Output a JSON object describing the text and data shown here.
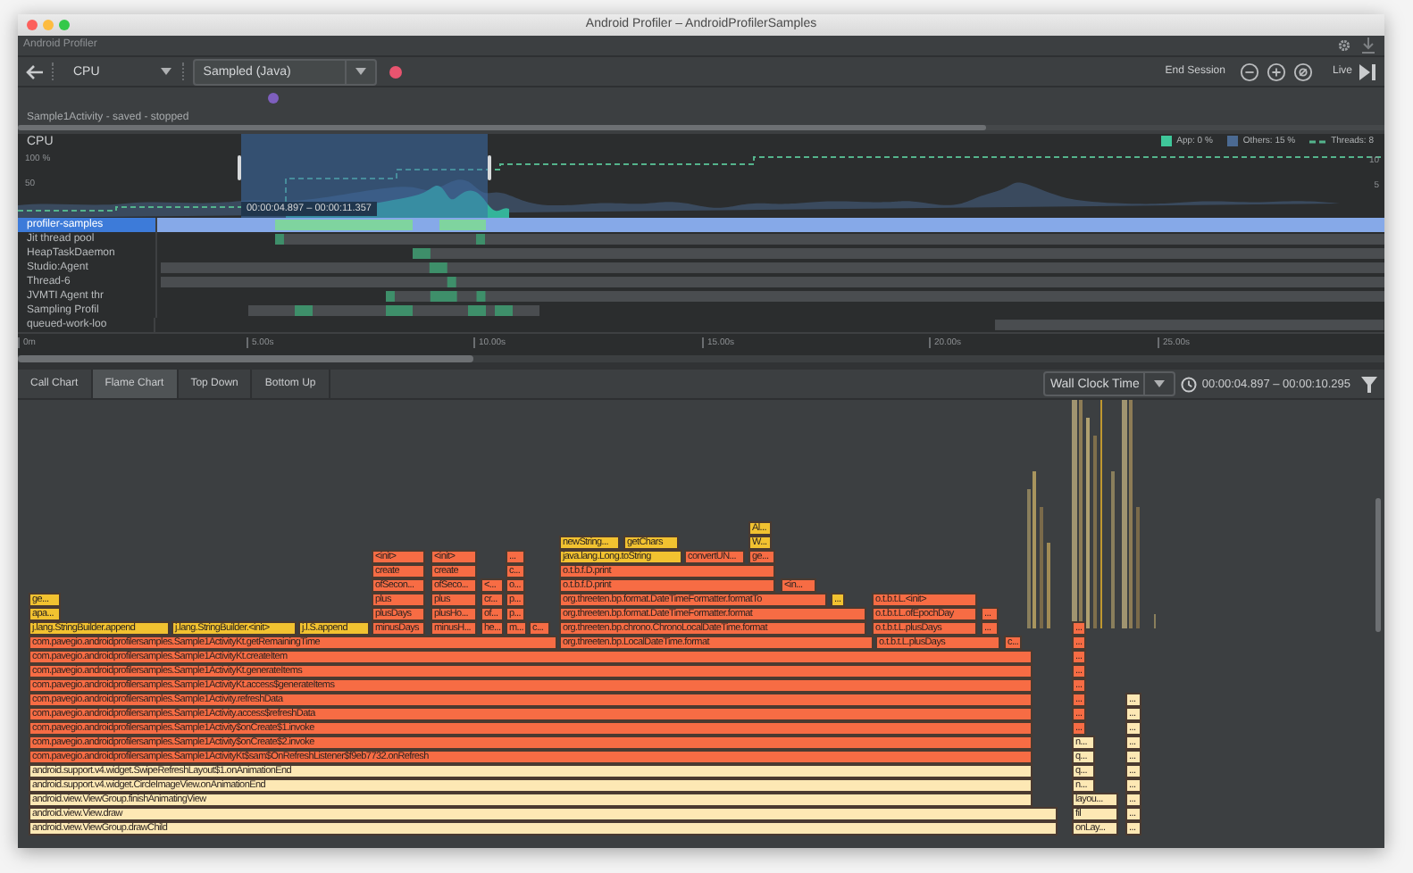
{
  "window": {
    "title": "Android Profiler – AndroidProfilerSamples"
  },
  "tool_window": {
    "title": "Android Profiler"
  },
  "toolbar": {
    "monitor": "CPU",
    "config": "Sampled (Java)",
    "end_session": "End Session",
    "live": "Live"
  },
  "session": {
    "label": "Sample1Activity - saved - stopped"
  },
  "cpu": {
    "title": "CPU",
    "y_labels": [
      "100 %",
      "50"
    ],
    "right_labels": [
      "10",
      "5"
    ],
    "legend": [
      {
        "label": "App: 0 %",
        "kind": "app"
      },
      {
        "label": "Others: 15 %",
        "kind": "others"
      },
      {
        "label": "Threads: 8",
        "kind": "threads"
      }
    ],
    "selection_range": "00:00:04.897 – 00:00:11.357"
  },
  "threads": [
    {
      "name": "profiler-samples",
      "selected": true
    },
    {
      "name": "Jit thread pool",
      "selected": false
    },
    {
      "name": "HeapTaskDaemon",
      "selected": false
    },
    {
      "name": "Studio:Agent",
      "selected": false
    },
    {
      "name": "Thread-6",
      "selected": false
    },
    {
      "name": "JVMTI Agent thr",
      "selected": false
    },
    {
      "name": "Sampling Profil",
      "selected": false
    },
    {
      "name": "queued-work-loo",
      "selected": false
    }
  ],
  "time_axis": [
    "0m",
    "5.00s",
    "10.00s",
    "15.00s",
    "20.00s",
    "25.00s"
  ],
  "tabs": [
    {
      "label": "Call Chart",
      "selected": false
    },
    {
      "label": "Flame Chart",
      "selected": true
    },
    {
      "label": "Top Down",
      "selected": false
    },
    {
      "label": "Bottom Up",
      "selected": false
    }
  ],
  "clock": {
    "label": "Wall Clock Time"
  },
  "range": "00:00:04.897 – 00:00:10.295",
  "flame_chart": {
    "rows": [
      {
        "frames": [
          {
            "label": "Al...",
            "kind": "library"
          }
        ]
      },
      {
        "frames": [
          {
            "label": "newString...",
            "kind": "library"
          },
          {
            "label": "getChars",
            "kind": "library"
          },
          {
            "label": "W...",
            "kind": "library"
          }
        ]
      },
      {
        "frames": [
          {
            "label": "<init>",
            "kind": "app"
          },
          {
            "label": "<init>",
            "kind": "app"
          },
          {
            "label": "...",
            "kind": "app"
          },
          {
            "label": "java.lang.Long.toString",
            "kind": "library"
          },
          {
            "label": "convertUN...",
            "kind": "app"
          },
          {
            "label": "ge...",
            "kind": "app"
          }
        ]
      },
      {
        "frames": [
          {
            "label": "create",
            "kind": "app"
          },
          {
            "label": "create",
            "kind": "app"
          },
          {
            "label": "c...",
            "kind": "app"
          },
          {
            "label": "o.t.b.f.D.print",
            "kind": "app"
          }
        ]
      },
      {
        "frames": [
          {
            "label": "ofSecon...",
            "kind": "app"
          },
          {
            "label": "ofSeco...",
            "kind": "app"
          },
          {
            "label": "<...",
            "kind": "app"
          },
          {
            "label": "o...",
            "kind": "app"
          },
          {
            "label": "o.t.b.f.D.print",
            "kind": "app"
          },
          {
            "label": "<in...",
            "kind": "app"
          }
        ]
      },
      {
        "frames": [
          {
            "label": "ge...",
            "kind": "library"
          },
          {
            "label": "plus",
            "kind": "app"
          },
          {
            "label": "plus",
            "kind": "app"
          },
          {
            "label": "cr...",
            "kind": "app"
          },
          {
            "label": "p...",
            "kind": "app"
          },
          {
            "label": "org.threeten.bp.format.DateTimeFormatter.formatTo",
            "kind": "app"
          },
          {
            "label": "...",
            "kind": "library"
          },
          {
            "label": "o.t.b.t.L.<init>",
            "kind": "app"
          }
        ]
      },
      {
        "frames": [
          {
            "label": "apa...",
            "kind": "library"
          },
          {
            "label": "plusDays",
            "kind": "app"
          },
          {
            "label": "plusHo...",
            "kind": "app"
          },
          {
            "label": "of...",
            "kind": "app"
          },
          {
            "label": "p...",
            "kind": "app"
          },
          {
            "label": "org.threeten.bp.format.DateTimeFormatter.format",
            "kind": "app"
          },
          {
            "label": "o.t.b.t.L.ofEpochDay",
            "kind": "app"
          },
          {
            "label": "...",
            "kind": "app"
          }
        ]
      },
      {
        "frames": [
          {
            "label": "j.lang.StringBuilder.append",
            "kind": "library"
          },
          {
            "label": "j.lang.StringBuilder.<init>",
            "kind": "library"
          },
          {
            "label": "j.l.S.append",
            "kind": "library"
          },
          {
            "label": "minusDays",
            "kind": "app"
          },
          {
            "label": "minusH...",
            "kind": "app"
          },
          {
            "label": "he...",
            "kind": "app"
          },
          {
            "label": "m...",
            "kind": "app"
          },
          {
            "label": "c...",
            "kind": "app"
          },
          {
            "label": "org.threeten.bp.chrono.ChronoLocalDateTime.format",
            "kind": "app"
          },
          {
            "label": "o.t.b.t.L.plusDays",
            "kind": "app"
          },
          {
            "label": "...",
            "kind": "app"
          },
          {
            "label": "...",
            "kind": "app"
          }
        ]
      },
      {
        "frames": [
          {
            "label": "com.pavegio.androidprofilersamples.Sample1ActivityKt.getRemainingTime",
            "kind": "app"
          },
          {
            "label": "org.threeten.bp.LocalDateTime.format",
            "kind": "app"
          },
          {
            "label": "o.t.b.t.L.plusDays",
            "kind": "app"
          },
          {
            "label": "c...",
            "kind": "app"
          },
          {
            "label": "...",
            "kind": "app"
          }
        ]
      },
      {
        "frames": [
          {
            "label": "com.pavegio.androidprofilersamples.Sample1ActivityKt.createItem",
            "kind": "app"
          },
          {
            "label": "...",
            "kind": "app"
          }
        ]
      },
      {
        "frames": [
          {
            "label": "com.pavegio.androidprofilersamples.Sample1ActivityKt.generateItems",
            "kind": "app"
          },
          {
            "label": "...",
            "kind": "app"
          }
        ]
      },
      {
        "frames": [
          {
            "label": "com.pavegio.androidprofilersamples.Sample1ActivityKt.access$generateItems",
            "kind": "app"
          },
          {
            "label": "...",
            "kind": "app"
          }
        ]
      },
      {
        "frames": [
          {
            "label": "com.pavegio.androidprofilersamples.Sample1Activity.refreshData",
            "kind": "app"
          },
          {
            "label": "...",
            "kind": "app"
          },
          {
            "label": "...",
            "kind": "system"
          }
        ]
      },
      {
        "frames": [
          {
            "label": "com.pavegio.androidprofilersamples.Sample1Activity.access$refreshData",
            "kind": "app"
          },
          {
            "label": "...",
            "kind": "app"
          },
          {
            "label": "...",
            "kind": "system"
          }
        ]
      },
      {
        "frames": [
          {
            "label": "com.pavegio.androidprofilersamples.Sample1Activity$onCreate$1.invoke",
            "kind": "app"
          },
          {
            "label": "...",
            "kind": "app"
          },
          {
            "label": "...",
            "kind": "system"
          }
        ]
      },
      {
        "frames": [
          {
            "label": "com.pavegio.androidprofilersamples.Sample1Activity$onCreate$2.invoke",
            "kind": "app"
          },
          {
            "label": "n...",
            "kind": "system"
          },
          {
            "label": "...",
            "kind": "system"
          }
        ]
      },
      {
        "frames": [
          {
            "label": "com.pavegio.androidprofilersamples.Sample1ActivityKt$sam$OnRefreshListener$f9eb7732.onRefresh",
            "kind": "app"
          },
          {
            "label": "q...",
            "kind": "system"
          },
          {
            "label": "...",
            "kind": "system"
          }
        ]
      },
      {
        "frames": [
          {
            "label": "android.support.v4.widget.SwipeRefreshLayout$1.onAnimationEnd",
            "kind": "system"
          },
          {
            "label": "q...",
            "kind": "system"
          },
          {
            "label": "...",
            "kind": "system"
          }
        ]
      },
      {
        "frames": [
          {
            "label": "android.support.v4.widget.CircleImageView.onAnimationEnd",
            "kind": "system"
          },
          {
            "label": "n...",
            "kind": "system"
          },
          {
            "label": "...",
            "kind": "system"
          }
        ]
      },
      {
        "frames": [
          {
            "label": "android.view.ViewGroup.finishAnimatingView",
            "kind": "system"
          },
          {
            "label": "layou...",
            "kind": "system"
          },
          {
            "label": "...",
            "kind": "system"
          }
        ]
      },
      {
        "frames": [
          {
            "label": "android.view.View.draw",
            "kind": "system"
          },
          {
            "label": "fil",
            "kind": "system"
          },
          {
            "label": "...",
            "kind": "system"
          }
        ]
      },
      {
        "frames": [
          {
            "label": "android.view.ViewGroup.drawChild",
            "kind": "system"
          },
          {
            "label": "onLay...",
            "kind": "system"
          },
          {
            "label": "...",
            "kind": "system"
          }
        ]
      }
    ]
  }
}
